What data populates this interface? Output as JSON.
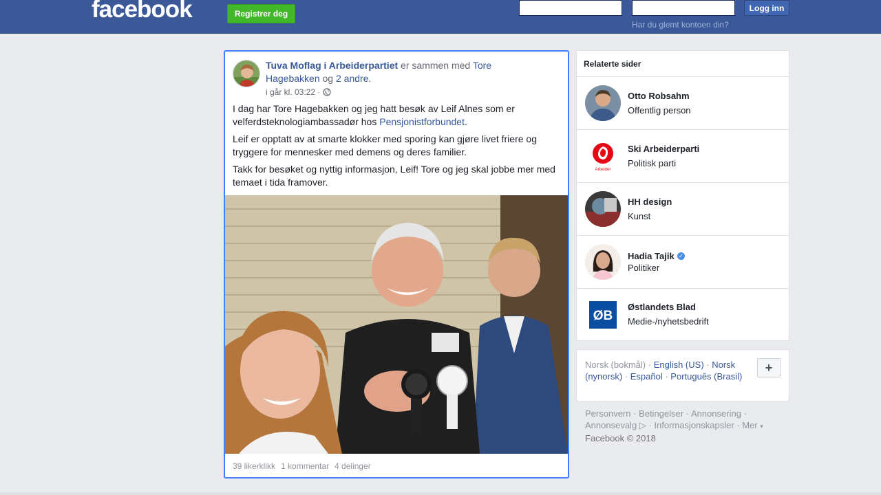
{
  "header": {
    "logo": "facebook",
    "register_label": "Registrer deg",
    "login_label": "Logg inn",
    "forgot_label": "Har du glemt kontoen din?",
    "email_value": "",
    "password_value": ""
  },
  "post": {
    "author": "Tuva Moflag i Arbeiderpartiet",
    "with_text": "er sammen med",
    "tagged": "Tore Hagebakken",
    "and_text": "og",
    "others": "2 andre.",
    "time": "i går kl. 03:22 ·",
    "paragraph1_a": "I dag har Tore Hagebakken og jeg hatt besøk av Leif Alnes som er velferdsteknologiambassadør hos",
    "paragraph1_link": "Pensjonistforbundet",
    "paragraph1_end": ".",
    "paragraph2": "Leif er opptatt av at smarte klokker med sporing kan gjøre livet friere og tryggere for mennesker med demens og deres familier.",
    "paragraph3": "Takk for besøket og nyttig informasjon, Leif! Tore og jeg skal jobbe mer med temaet i tida framover.",
    "likes": "39 likerklikk",
    "comments": "1 kommentar",
    "shares": "4 delinger"
  },
  "related": {
    "title": "Relaterte sider",
    "items": [
      {
        "name": "Otto Robsahm",
        "category": "Offentlig person"
      },
      {
        "name": "Ski Arbeiderparti",
        "category": "Politisk parti"
      },
      {
        "name": "HH design",
        "category": "Kunst"
      },
      {
        "name": "Hadia Tajik",
        "category": "Politiker"
      },
      {
        "name": "Østlandets Blad",
        "category": "Medie-/nyhetsbedrift"
      }
    ]
  },
  "languages": {
    "current": "Norsk (bokmål)",
    "options": [
      "English (US)",
      "Norsk (nynorsk)",
      "Español",
      "Português (Brasil)"
    ],
    "more_symbol": "+"
  },
  "footer": {
    "links": [
      "Personvern",
      "Betingelser",
      "Annonsering",
      "Annonsevalg",
      "Informasjonskapsler",
      "Mer"
    ],
    "copyright": "Facebook © 2018"
  },
  "colors": {
    "brand": "#3b5998",
    "register": "#42b72a",
    "link": "#365899",
    "focus": "#4080ff"
  }
}
